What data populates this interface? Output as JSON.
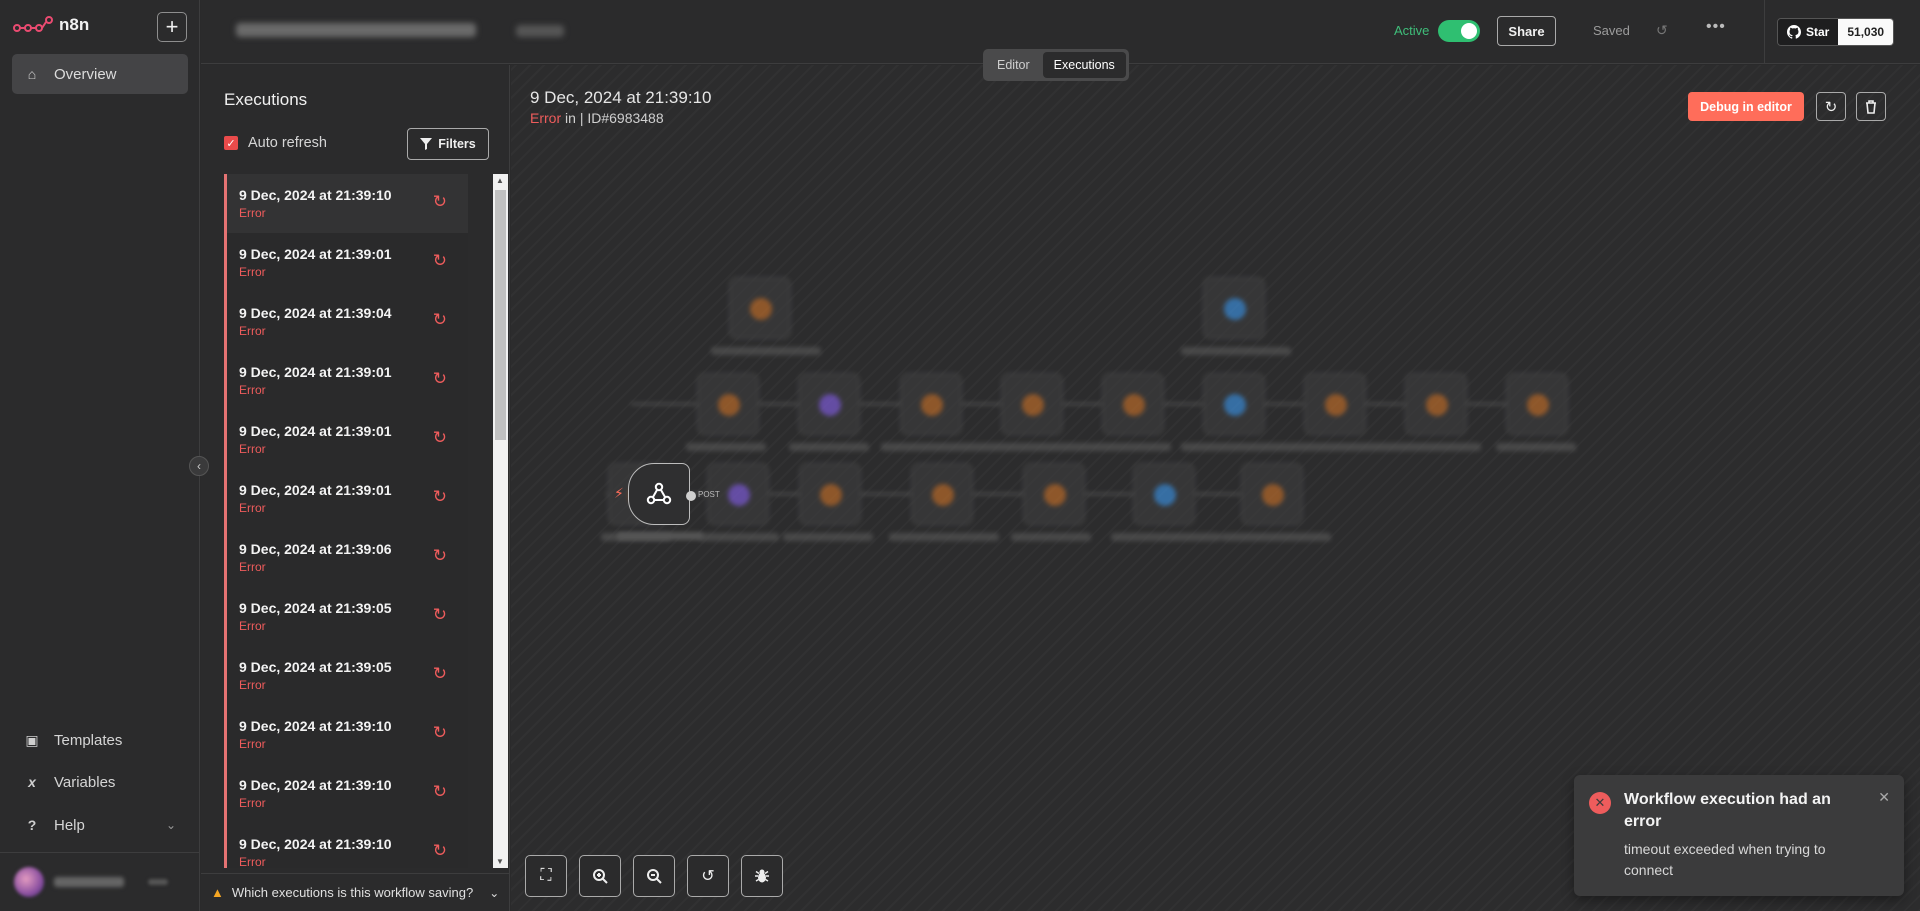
{
  "app": {
    "logo_text": "n8n"
  },
  "sidebar": {
    "add_label": "+",
    "items": [
      {
        "label": "Overview"
      },
      {
        "label": "Templates"
      },
      {
        "label": "Variables"
      },
      {
        "label": "Help"
      }
    ],
    "collapse_icon": "chevron-left-icon"
  },
  "header": {
    "active_label": "Active",
    "share_label": "Share",
    "saved_label": "Saved",
    "github": {
      "star_label": "Star",
      "count": "51,030"
    }
  },
  "tabs": [
    {
      "label": "Editor",
      "active": false
    },
    {
      "label": "Executions",
      "active": true
    }
  ],
  "executions_panel": {
    "title": "Executions",
    "auto_refresh_label": "Auto refresh",
    "auto_refresh_checked": true,
    "filters_label": "Filters",
    "items": [
      {
        "date": "9 Dec, 2024 at 21:39:10",
        "status": "Error"
      },
      {
        "date": "9 Dec, 2024 at 21:39:01",
        "status": "Error"
      },
      {
        "date": "9 Dec, 2024 at 21:39:04",
        "status": "Error"
      },
      {
        "date": "9 Dec, 2024 at 21:39:01",
        "status": "Error"
      },
      {
        "date": "9 Dec, 2024 at 21:39:01",
        "status": "Error"
      },
      {
        "date": "9 Dec, 2024 at 21:39:01",
        "status": "Error"
      },
      {
        "date": "9 Dec, 2024 at 21:39:06",
        "status": "Error"
      },
      {
        "date": "9 Dec, 2024 at 21:39:05",
        "status": "Error"
      },
      {
        "date": "9 Dec, 2024 at 21:39:05",
        "status": "Error"
      },
      {
        "date": "9 Dec, 2024 at 21:39:10",
        "status": "Error"
      },
      {
        "date": "9 Dec, 2024 at 21:39:10",
        "status": "Error"
      },
      {
        "date": "9 Dec, 2024 at 21:39:10",
        "status": "Error"
      }
    ],
    "saving_question": "Which executions is this workflow saving?"
  },
  "execution_detail": {
    "heading": "9 Dec, 2024 at 21:39:10",
    "status": "Error",
    "in_text": "in",
    "id_text": "| ID#6983488",
    "debug_label": "Debug in editor",
    "webhook_method": "POST"
  },
  "toast": {
    "title": "Workflow execution had an error",
    "message": "timeout exceeded when trying to connect"
  },
  "colors": {
    "accent": "#ff6d5a",
    "error": "#ee5c5c",
    "active_green": "#2fbf71"
  }
}
